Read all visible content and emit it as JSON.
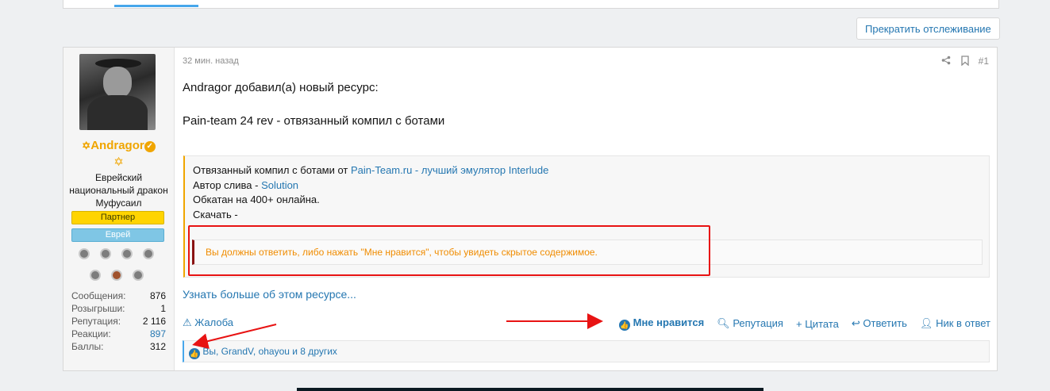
{
  "toolbar": {
    "unwatch_label": "Прекратить отслеживание"
  },
  "post": {
    "time": "32 мин. назад",
    "number": "#1",
    "body_line1": "Andragor добавил(а) новый ресурс:",
    "body_line2": "Pain-team 24 rev - отвязанный компил с ботами",
    "resource": {
      "line1_prefix": "Отвязанный компил с ботами от ",
      "line1_link": "Pain-Team.ru - лучший эмулятор Interlude",
      "line2_prefix": "Автор слива - ",
      "line2_link": "Solution",
      "line3": "Обкатан на 400+ онлайна.",
      "line4": "Скачать -",
      "hidden_notice": "Вы должны ответить, либо нажать \"Мне нравится\", чтобы увидеть скрытое содержимое."
    },
    "learn_more": "Узнать больше об этом ресурсе...",
    "actions": {
      "report": "Жалоба",
      "like": "Мне нравится",
      "reputation": "Репутация",
      "quote": "Цитата",
      "reply": "Ответить",
      "mention": "Ник в ответ"
    },
    "likes_text": "Вы, GrandV, ohayou и 8 других"
  },
  "user": {
    "name": "Andragor",
    "title": "Еврейский национальный дракон Муфусаил",
    "banner_partner": "Партнер",
    "banner_group": "Еврей",
    "stats": [
      {
        "label": "Сообщения:",
        "value": "876"
      },
      {
        "label": "Розыгрыши:",
        "value": "1"
      },
      {
        "label": "Репутация:",
        "value": "2 116"
      },
      {
        "label": "Реакции:",
        "value": "897"
      },
      {
        "label": "Баллы:",
        "value": "312"
      }
    ]
  },
  "colors": {
    "accent": "#2577b1",
    "username": "#f0a500",
    "highlight_frame": "#e81313"
  }
}
